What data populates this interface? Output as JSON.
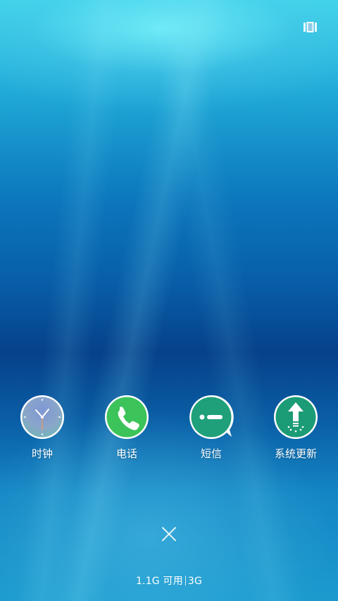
{
  "apps": [
    {
      "id": "clock",
      "label": "时钟",
      "icon": "clock-icon"
    },
    {
      "id": "phone",
      "label": "电话",
      "icon": "phone-icon"
    },
    {
      "id": "messages",
      "label": "短信",
      "icon": "message-icon"
    },
    {
      "id": "system_update",
      "label": "系统更新",
      "icon": "system-update-icon"
    }
  ],
  "close_icon": "close-icon",
  "view_toggle_icon": "multi-window-icon",
  "memory": {
    "available": "1.1G 可用",
    "network": "3G"
  },
  "colors": {
    "phone_green": "#3cc35a",
    "message_teal": "#1fa07a",
    "update_teal": "#1b9b76",
    "clock_face": "#8c9fd2"
  }
}
